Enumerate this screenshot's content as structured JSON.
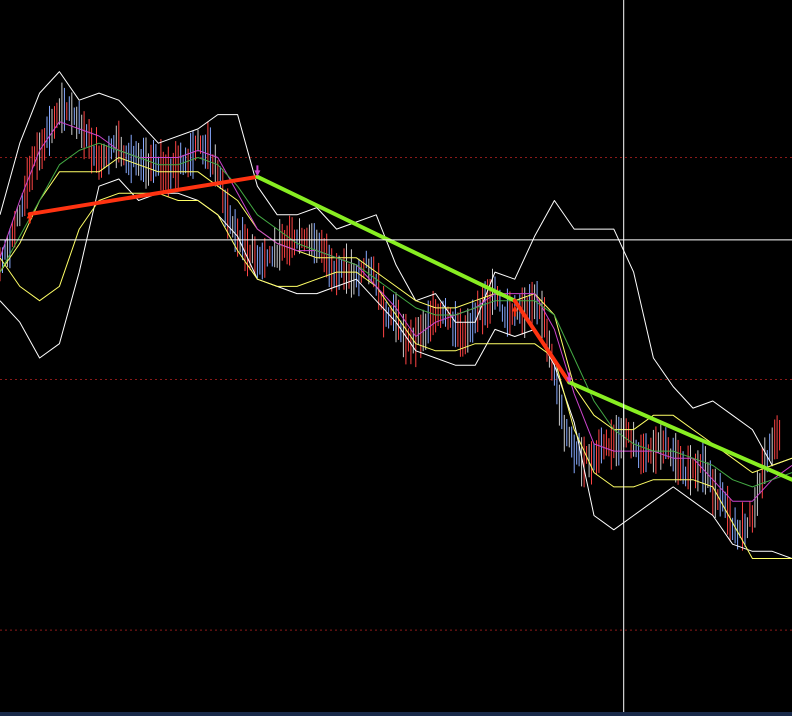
{
  "chart_data": {
    "type": "line",
    "title": "",
    "xlabel": "",
    "ylabel": "",
    "xlim": [
      0,
      160
    ],
    "ylim": [
      0,
      100
    ],
    "grid": "dotted-horizontal",
    "legend": "none",
    "colors": {
      "background": "#000000",
      "grid": "#8b1a1a",
      "crosshair": "#ffffff",
      "outer_band": "#ffffff",
      "inner_band": "#ffff66",
      "ma_fast": "#cc44cc",
      "ma_slow": "#44aa44",
      "trend_up": "#ff3311",
      "trend_down": "#88ee22",
      "candle_up": "#88aaff",
      "candle_down": "#ff4444",
      "candle_neutral": "#cccccc"
    },
    "gridlines_y": [
      78,
      47,
      12
    ],
    "crosshair": {
      "x": 126,
      "y": 66.5
    },
    "series": [
      {
        "key": "outer_upper",
        "x": [
          0,
          4,
          8,
          12,
          16,
          20,
          24,
          32,
          40,
          44,
          48,
          52,
          56,
          60,
          64,
          68,
          72,
          76,
          80,
          84,
          88,
          92,
          96,
          100,
          104,
          108,
          112,
          116,
          120,
          124,
          128,
          132,
          136,
          140,
          144,
          148,
          152,
          156,
          160
        ],
        "values": [
          70,
          80,
          87,
          90,
          86,
          87,
          86,
          80,
          82,
          84,
          84,
          74,
          70,
          70,
          71,
          68,
          69,
          70,
          63,
          58,
          59,
          55,
          55,
          62,
          61,
          67,
          72,
          68,
          68,
          68,
          62,
          50,
          46,
          43,
          44,
          42,
          40,
          35,
          36
        ]
      },
      {
        "key": "outer_lower",
        "x": [
          0,
          4,
          8,
          12,
          16,
          20,
          24,
          28,
          32,
          36,
          40,
          44,
          48,
          52,
          56,
          60,
          64,
          68,
          72,
          76,
          80,
          84,
          88,
          92,
          96,
          100,
          104,
          108,
          112,
          116,
          120,
          124,
          128,
          132,
          136,
          140,
          144,
          148,
          152,
          156,
          160
        ],
        "values": [
          58,
          55,
          50,
          52,
          62,
          74,
          75,
          72,
          73,
          73,
          72,
          70,
          67,
          61,
          60,
          59,
          59,
          60,
          61,
          58,
          55,
          51,
          50,
          49,
          49,
          54,
          53,
          54,
          49,
          41,
          28,
          26,
          28,
          30,
          32,
          30,
          28,
          24,
          23,
          23,
          22
        ]
      },
      {
        "key": "inner_upper",
        "x": [
          0,
          4,
          8,
          12,
          16,
          20,
          24,
          28,
          32,
          36,
          40,
          44,
          48,
          52,
          56,
          60,
          64,
          68,
          72,
          76,
          80,
          84,
          88,
          92,
          96,
          100,
          104,
          108,
          112,
          116,
          120,
          124,
          128,
          132,
          136,
          140,
          144,
          148,
          152,
          156,
          160
        ],
        "values": [
          62,
          66,
          72,
          76,
          76,
          76,
          78,
          77,
          76,
          76,
          76,
          74,
          72,
          68,
          66,
          65,
          64,
          64,
          64,
          62,
          60,
          58,
          57,
          57,
          58,
          59,
          58,
          59,
          56,
          46,
          42,
          40,
          40,
          42,
          42,
          40,
          38,
          36,
          34,
          35,
          36
        ]
      },
      {
        "key": "inner_lower",
        "x": [
          0,
          4,
          8,
          12,
          16,
          20,
          24,
          28,
          32,
          36,
          40,
          44,
          48,
          52,
          56,
          60,
          64,
          68,
          72,
          76,
          80,
          84,
          88,
          92,
          96,
          100,
          104,
          108,
          112,
          116,
          120,
          124,
          128,
          132,
          136,
          140,
          144,
          148,
          152,
          156,
          160
        ],
        "values": [
          64,
          60,
          58,
          60,
          68,
          72,
          73,
          73,
          73,
          72,
          72,
          70,
          65,
          61,
          60,
          60,
          61,
          62,
          62,
          60,
          56,
          52,
          51,
          51,
          52,
          52,
          52,
          52,
          50,
          40,
          34,
          32,
          32,
          33,
          33,
          33,
          32,
          27,
          22,
          22,
          22
        ]
      },
      {
        "key": "ma_fast",
        "x": [
          0,
          4,
          8,
          12,
          16,
          20,
          24,
          28,
          32,
          36,
          40,
          44,
          48,
          52,
          56,
          60,
          64,
          68,
          72,
          76,
          80,
          84,
          88,
          92,
          96,
          100,
          104,
          108,
          112,
          116,
          120,
          124,
          128,
          132,
          136,
          140,
          144,
          148,
          152,
          156,
          160
        ],
        "values": [
          64,
          72,
          79,
          83,
          82,
          81,
          79,
          78,
          78,
          78,
          79,
          78,
          73,
          68,
          66,
          65,
          65,
          64,
          63,
          60,
          57,
          53,
          55,
          56,
          57,
          59,
          59,
          59,
          54,
          45,
          38,
          37,
          37,
          37,
          36,
          36,
          33,
          30,
          30,
          33,
          35
        ]
      },
      {
        "key": "ma_slow",
        "x": [
          0,
          4,
          8,
          12,
          16,
          20,
          24,
          28,
          32,
          36,
          40,
          44,
          48,
          52,
          56,
          60,
          64,
          68,
          72,
          76,
          80,
          84,
          88,
          92,
          96,
          100,
          104,
          108,
          112,
          116,
          120,
          124,
          128,
          132,
          136,
          140,
          144,
          148,
          152,
          156,
          160
        ],
        "values": [
          62,
          67,
          72,
          77,
          79,
          80,
          79,
          78,
          77,
          77,
          78,
          77,
          74,
          70,
          68,
          66,
          65,
          64,
          63,
          61,
          59,
          57,
          56,
          56,
          57,
          58,
          58,
          58,
          56,
          50,
          44,
          40,
          38,
          37,
          37,
          36,
          35,
          33,
          32,
          33,
          34
        ]
      },
      {
        "key": "close",
        "x": [
          0,
          2,
          4,
          6,
          8,
          10,
          12,
          14,
          16,
          18,
          20,
          22,
          24,
          26,
          28,
          30,
          32,
          34,
          36,
          38,
          40,
          42,
          44,
          46,
          48,
          50,
          52,
          54,
          56,
          58,
          60,
          62,
          64,
          66,
          68,
          70,
          72,
          74,
          76,
          78,
          80,
          82,
          84,
          86,
          88,
          90,
          92,
          94,
          96,
          98,
          100,
          102,
          104,
          106,
          108,
          110,
          112,
          114,
          116,
          118,
          120,
          122,
          124,
          126,
          128,
          130,
          132,
          134,
          136,
          138,
          140,
          142,
          144,
          146,
          148,
          150,
          152,
          154,
          156,
          158
        ],
        "values": [
          63,
          66,
          70,
          76,
          79,
          82,
          84,
          85,
          83,
          80,
          78,
          79,
          80,
          78,
          77,
          77,
          77,
          76,
          77,
          78,
          80,
          79,
          76,
          70,
          67,
          65,
          64,
          64,
          65,
          66,
          67,
          67,
          66,
          64,
          62,
          62,
          61,
          63,
          61,
          56,
          56,
          52,
          53,
          54,
          56,
          57,
          54,
          53,
          55,
          58,
          59,
          56,
          57,
          57,
          58,
          55,
          48,
          40,
          37,
          36,
          36,
          38,
          38,
          40,
          38,
          36,
          37,
          38,
          36,
          34,
          35,
          35,
          32,
          30,
          26,
          26,
          28,
          34,
          38,
          39
        ]
      }
    ],
    "trend_lines": [
      {
        "key": "trend_1",
        "direction": "up",
        "from": [
          6,
          70.1
        ],
        "to": [
          52,
          75.3
        ]
      },
      {
        "key": "trend_2",
        "direction": "down",
        "from": [
          52,
          75.3
        ],
        "to": [
          104,
          58
        ]
      },
      {
        "key": "trend_3",
        "direction": "down",
        "from": [
          104,
          58
        ],
        "to": [
          115,
          46.6
        ]
      },
      {
        "key": "trend_4",
        "direction": "down",
        "from": [
          115,
          46.6
        ],
        "to": [
          160,
          33
        ]
      }
    ],
    "signals": [
      {
        "type": "buy",
        "x": 6,
        "y": 69.5
      },
      {
        "type": "sell",
        "x": 52,
        "y": 76.2
      },
      {
        "type": "buy",
        "x": 104,
        "y": 56.5
      },
      {
        "type": "sell",
        "x": 115,
        "y": 47.3
      }
    ]
  }
}
